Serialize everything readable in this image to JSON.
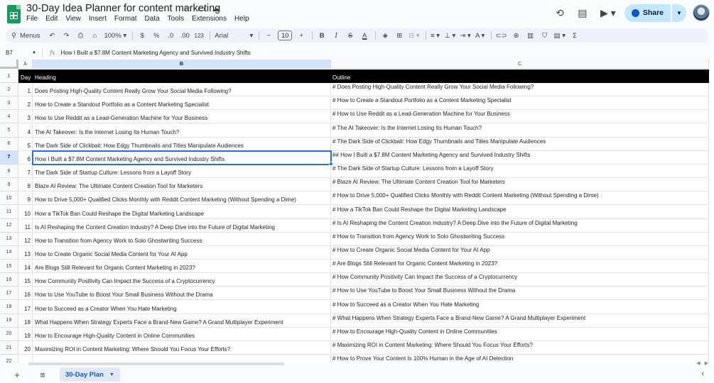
{
  "doc": {
    "title": "30-Day Idea Planner for content marketing",
    "star_icon": "star-icon",
    "move_icon": "folder-icon",
    "cloud_icon": "cloud-status-icon"
  },
  "menu": [
    "File",
    "Edit",
    "View",
    "Insert",
    "Format",
    "Data",
    "Tools",
    "Extensions",
    "Help"
  ],
  "top_actions": {
    "share_label": "Share"
  },
  "toolbar": {
    "menus_label": "Menus",
    "zoom": "100%",
    "currency": "$",
    "percent": "%",
    "decrease_decimal": ".0",
    "increase_decimal": ".00",
    "number_format": "123",
    "font": "Arial",
    "font_size": "10",
    "minus": "−",
    "plus": "+",
    "bold": "B",
    "italic": "I",
    "strike": "S",
    "text_color": "A",
    "sigma": "Σ"
  },
  "formula": {
    "cell_ref": "B7",
    "fx": "fx",
    "content": "How I Built a $7.8M Content Marketing Agency and Survived Industry Shifts"
  },
  "columns": [
    "A",
    "B",
    "C"
  ],
  "selected_column": "B",
  "selected_row": 7,
  "header": {
    "day": "Day",
    "heading": "Heading",
    "outline": "Outline"
  },
  "rows": [
    {
      "num": "2",
      "day": "1",
      "heading": "Does Posting High-Quality Content Really Grow Your Social Media Following?",
      "outline": "# Does Posting High-Quality Content Really Grow Your Social Media Following?"
    },
    {
      "num": "3",
      "day": "2",
      "heading": "How to Create a Standout Portfolio as a Content Marketing Specialist",
      "outline": "# How to Create a Standout Portfolio as a Content Marketing Specialist"
    },
    {
      "num": "4",
      "day": "3",
      "heading": "How to Use Reddit as a Lead-Generation Machine for Your Business",
      "outline": "# How to Use Reddit as a Lead-Generation Machine for Your Business"
    },
    {
      "num": "5",
      "day": "4",
      "heading": "The AI Takeover: Is the Internet Losing Its Human Touch?",
      "outline": "# The AI Takeover: Is the Internet Losing Its Human Touch?"
    },
    {
      "num": "6",
      "day": "5",
      "heading": "The Dark Side of Clickbait: How Edgy Thumbnails and Titles Manipulate Audiences",
      "outline": "# The Dark Side of Clickbait: How Edgy Thumbnails and Titles Manipulate Audiences"
    },
    {
      "num": "7",
      "day": "6",
      "heading": "How I Built a $7.8M Content Marketing Agency and Survived Industry Shifts",
      "outline": "## How I Built a $7.8M Content Marketing Agency and Survived Industry Shifts"
    },
    {
      "num": "8",
      "day": "7",
      "heading": "The Dark Side of Startup Culture: Lessons from a Layoff Story",
      "outline": "# The Dark Side of Startup Culture: Lessons from a Layoff Story"
    },
    {
      "num": "9",
      "day": "8",
      "heading": "Blaze AI Review: The Ultimate Content Creation Tool for Marketers",
      "outline": "# Blaze AI Review: The Ultimate Content Creation Tool for Marketers"
    },
    {
      "num": "10",
      "day": "9",
      "heading": "How to Drive 5,000+ Qualified Clicks Monthly with Reddit Content Marketing (Without Spending a Dime)",
      "outline": "# How to Drive 5,000+ Qualified Clicks Monthly with Reddit Content Marketing (Without Spending a Dime)"
    },
    {
      "num": "11",
      "day": "10",
      "heading": "How a TikTok Ban Could Reshape the Digital Marketing Landscape",
      "outline": "# How a TikTok Ban Could Reshape the Digital Marketing Landscape"
    },
    {
      "num": "12",
      "day": "11",
      "heading": "Is AI Reshaping the Content Creation Industry? A Deep Dive into the Future of Digital Marketing",
      "outline": "# Is AI Reshaping the Content Creation Industry? A Deep Dive into the Future of Digital Marketing"
    },
    {
      "num": "13",
      "day": "12",
      "heading": "How to Transition from Agency Work to Solo Ghostwriting Success",
      "outline": "# How to Transition from Agency Work to Solo Ghostwriting Success"
    },
    {
      "num": "14",
      "day": "13",
      "heading": "How to Create Organic Social Media Content for Your AI App",
      "outline": "# How to Create Organic Social Media Content for Your AI App"
    },
    {
      "num": "15",
      "day": "14",
      "heading": "Are Blogs Still Relevant for Organic Content Marketing in 2023?",
      "outline": "# Are Blogs Still Relevant for Organic Content Marketing in 2023?"
    },
    {
      "num": "16",
      "day": "15",
      "heading": "How Community Positivity Can Impact the Success of a Cryptocurrency",
      "outline": "# How Community Positivity Can Impact the Success of a Cryptocurrency"
    },
    {
      "num": "17",
      "day": "16",
      "heading": "How to Use YouTube to Boost Your Small Business Without the Drama",
      "outline": "# How to Use YouTube to Boost Your Small Business Without the Drama"
    },
    {
      "num": "18",
      "day": "17",
      "heading": "How to Succeed as a Creator When You Hate Marketing",
      "outline": "# How to Succeed as a Creator When You Hate Marketing"
    },
    {
      "num": "19",
      "day": "18",
      "heading": "What Happens When Strategy Experts Face a Brand-New Game? A Grand Multiplayer Experiment",
      "outline": "# What Happens When Strategy Experts Face a Brand-New Game? A Grand Multiplayer Experiment"
    },
    {
      "num": "20",
      "day": "19",
      "heading": "How to Encourage High-Quality Content in Online Communities",
      "outline": "# How to Encourage High-Quality Content in Online Communities"
    },
    {
      "num": "21",
      "day": "20",
      "heading": "Maximizing ROI in Content Marketing: Where Should You Focus Your Efforts?",
      "outline": "# Maximizing ROI in Content Marketing: Where Should You Focus Your Efforts?"
    },
    {
      "num": "22",
      "day": "",
      "heading": "",
      "outline": "# How to Prove Your Content Is 100% Human in the Age of AI Detection"
    }
  ],
  "sheet": {
    "tab_label": "30-Day Plan"
  },
  "colors": {
    "accent": "#0b57d0",
    "selection": "#1a73e8",
    "header_bg": "#000000",
    "sheets_green": "#0f9d58"
  }
}
